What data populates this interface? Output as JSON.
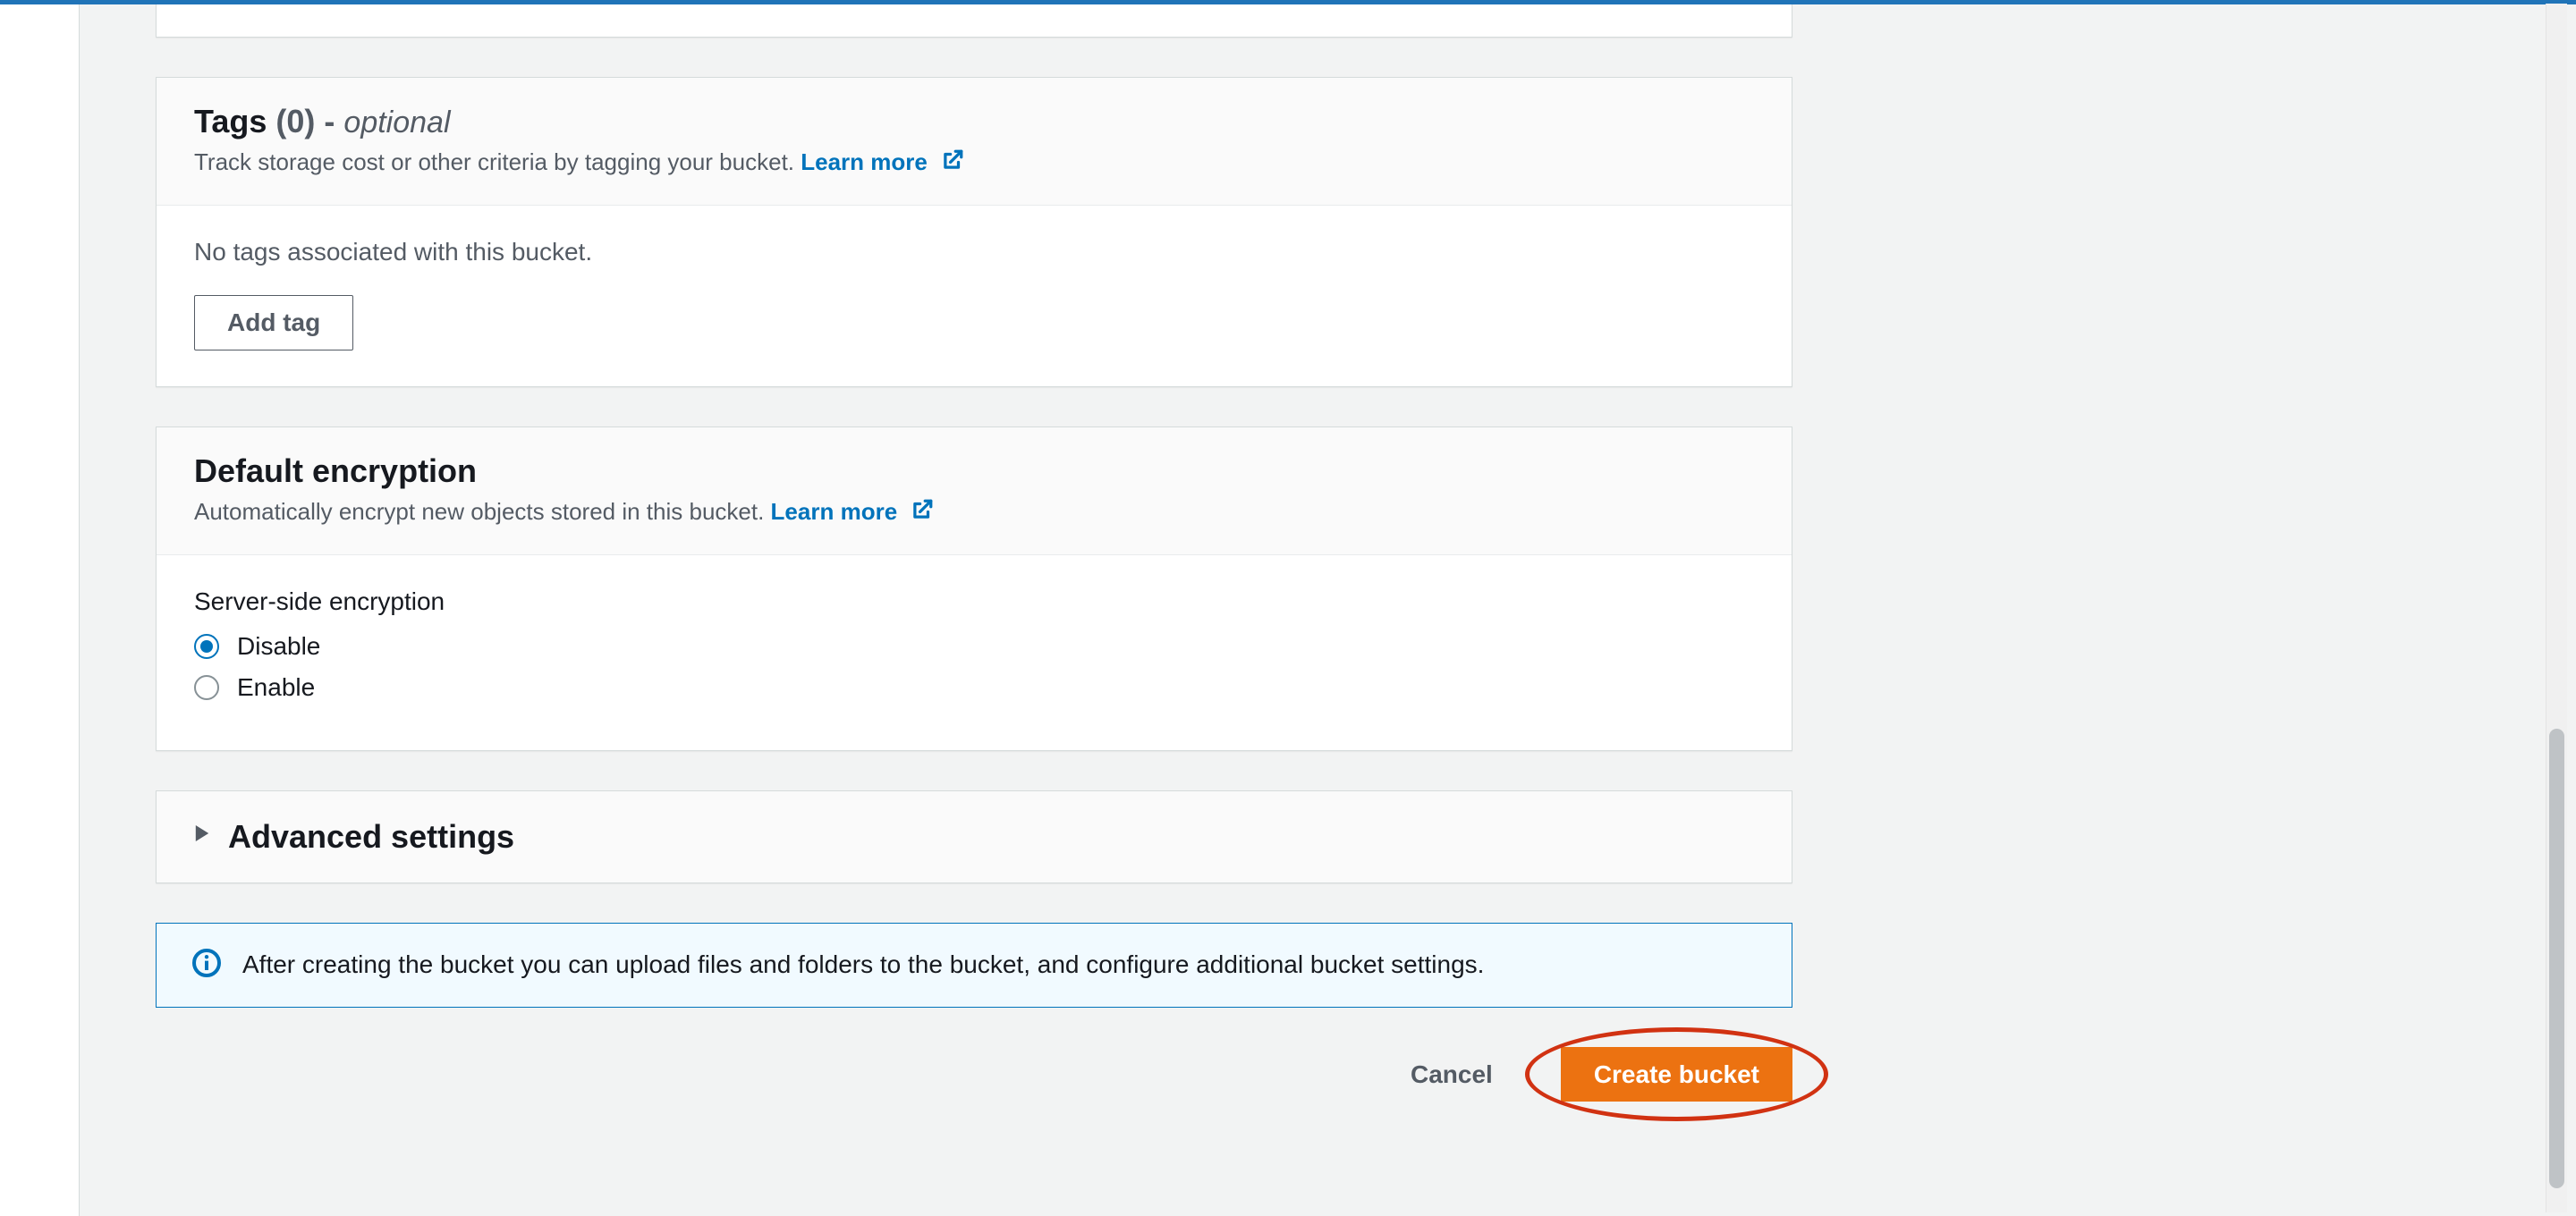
{
  "tags": {
    "title_main": "Tags",
    "title_count": "(0)",
    "title_dash": "-",
    "title_optional": "optional",
    "description": "Track storage cost or other criteria by tagging your bucket.",
    "learn_more": "Learn more",
    "empty": "No tags associated with this bucket.",
    "add_button": "Add tag"
  },
  "encryption": {
    "title": "Default encryption",
    "description": "Automatically encrypt new objects stored in this bucket.",
    "learn_more": "Learn more",
    "field_label": "Server-side encryption",
    "option_disable": "Disable",
    "option_enable": "Enable",
    "selected": "disable"
  },
  "advanced": {
    "title": "Advanced settings"
  },
  "info": {
    "text": "After creating the bucket you can upload files and folders to the bucket, and configure additional bucket settings."
  },
  "actions": {
    "cancel": "Cancel",
    "create": "Create bucket"
  }
}
